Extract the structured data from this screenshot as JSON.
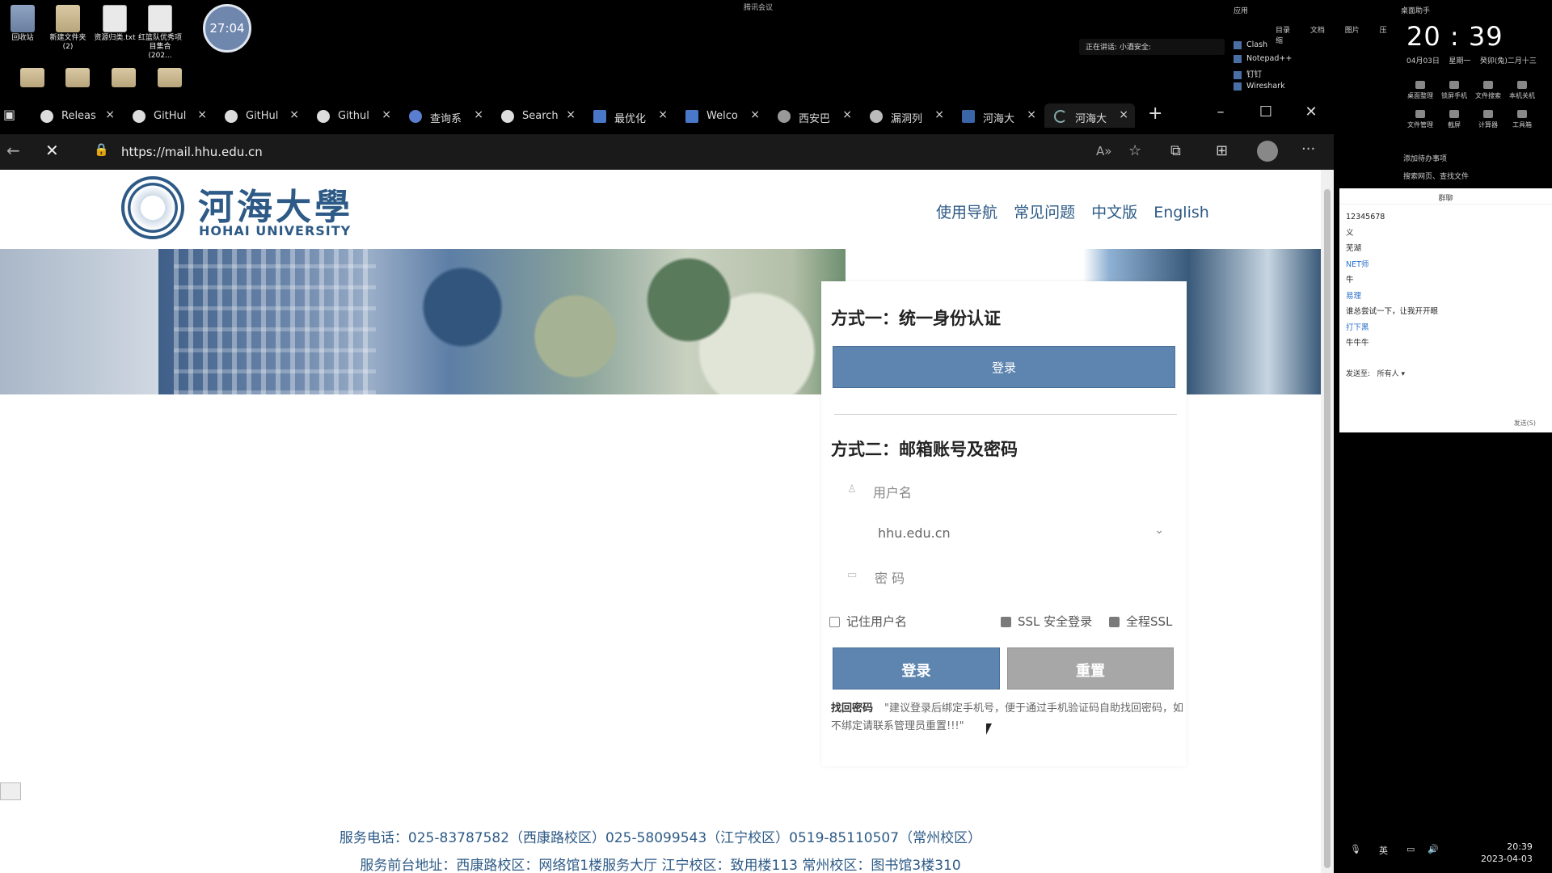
{
  "desktop": {
    "icons": [
      {
        "label": "回收站"
      },
      {
        "label": "新建文件夹 (2)"
      },
      {
        "label": "资源归类.txt"
      },
      {
        "label": "红篮队优秀项目集合(202..."
      }
    ],
    "clock_circle": "27:04",
    "meeting_bar": "腾讯会议",
    "speaking": "正在讲话: 小酒安全:"
  },
  "app_menu": {
    "header": "应用",
    "toolbar": [
      "目录",
      "文档",
      "图片",
      "压缩"
    ],
    "items": [
      "Clash",
      "Notepad++",
      "钉钉",
      "Wireshark"
    ]
  },
  "right_panel": {
    "header": "桌面助手",
    "time": "20 : 39",
    "date": "04月03日",
    "weekday": "星期一",
    "lunar": "癸卯(兔)二月十三",
    "tools_row1": [
      "桌面整理",
      "锁屏手机",
      "文件搜索",
      "本机关机"
    ],
    "tools_row2": [
      "文件管理",
      "截屏",
      "计算器",
      "工具箱"
    ],
    "links": [
      "添加待办事项",
      "搜索网页、查找文件"
    ]
  },
  "chat": {
    "title": "群聊",
    "messages": [
      {
        "text": "12345678",
        "blue": false
      },
      {
        "text": "义",
        "blue": false
      },
      {
        "text": "芜湖",
        "blue": false
      },
      {
        "text": "NET师",
        "blue": true
      },
      {
        "text": "牛",
        "blue": false
      },
      {
        "text": "易理",
        "blue": true
      },
      {
        "text": "谁总尝试一下，让我开开眼",
        "blue": false
      },
      {
        "text": "打下黑",
        "blue": true
      },
      {
        "text": "牛牛牛",
        "blue": false
      }
    ],
    "send_to_label": "发送至:",
    "send_to_value": "所有人",
    "send_button": "发送(S)"
  },
  "taskbar": {
    "lang": "英",
    "time": "20:39",
    "date": "2023-04-03"
  },
  "browser": {
    "tabs": [
      {
        "label": "Releas"
      },
      {
        "label": "GitHul"
      },
      {
        "label": "GitHul"
      },
      {
        "label": "Githul"
      },
      {
        "label": "查询系"
      },
      {
        "label": "Search"
      },
      {
        "label": "最优化"
      },
      {
        "label": "Welco"
      },
      {
        "label": "西安巴"
      },
      {
        "label": "漏洞列"
      },
      {
        "label": "河海大"
      },
      {
        "label": "河海大"
      }
    ],
    "new_tab": "+",
    "url": "https://mail.hhu.edu.cn"
  },
  "site": {
    "logo_cn": "河海大學",
    "logo_en": "HOHAI UNIVERSITY",
    "nav": [
      "使用导航",
      "常见问题",
      "中文版",
      "English"
    ],
    "method1_title": "方式一：统一身份认证",
    "method1_button": "登录",
    "method2_title": "方式二：邮箱账号及密码",
    "username_placeholder": "用户名",
    "domain_value": "hhu.edu.cn",
    "password_placeholder": "密  码",
    "remember_label": "记住用户名",
    "ssl_label": "SSL 安全登录",
    "full_ssl_label": "全程SSL",
    "login_button": "登录",
    "reset_button": "重置",
    "recover_label": "找回密码",
    "recover_note": "\"建议登录后绑定手机号，便于通过手机验证码自助找回密码，如不绑定请联系管理员重置!!!\"",
    "footer_phone": "服务电话：025-83787582（西康路校区）025-58099543（江宁校区）0519-85110507（常州校区）",
    "footer_address": "服务前台地址：西康路校区：网络馆1楼服务大厅    江宁校区：致用楼113    常州校区：图书馆3楼310"
  }
}
